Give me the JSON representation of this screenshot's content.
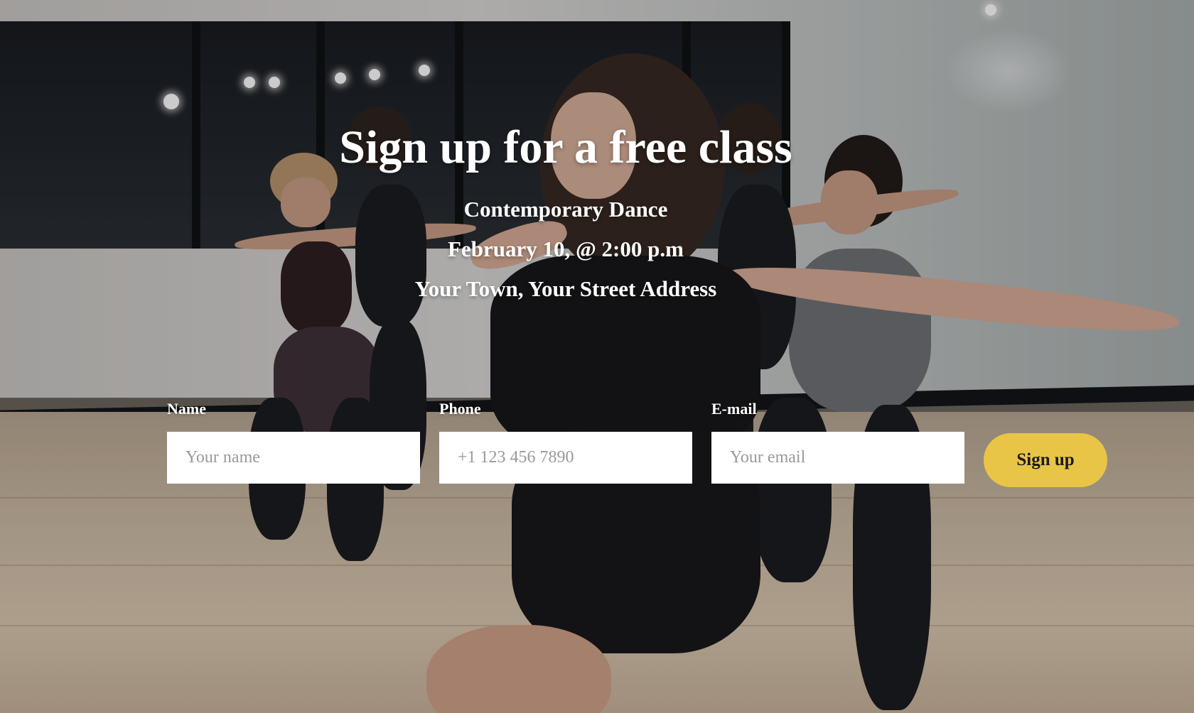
{
  "hero": {
    "title": "Sign up for a free class",
    "class_name": "Contemporary Dance",
    "date_time": "February 10, @ 2:00 p.m",
    "location": "Your Town, Your Street Address"
  },
  "form": {
    "name": {
      "label": "Name",
      "placeholder": "Your name"
    },
    "phone": {
      "label": "Phone",
      "placeholder": "+1 123 456 7890"
    },
    "email": {
      "label": "E-mail",
      "placeholder": "Your email"
    },
    "submit_label": "Sign up"
  },
  "colors": {
    "button": "#e8c547",
    "text": "#ffffff"
  }
}
